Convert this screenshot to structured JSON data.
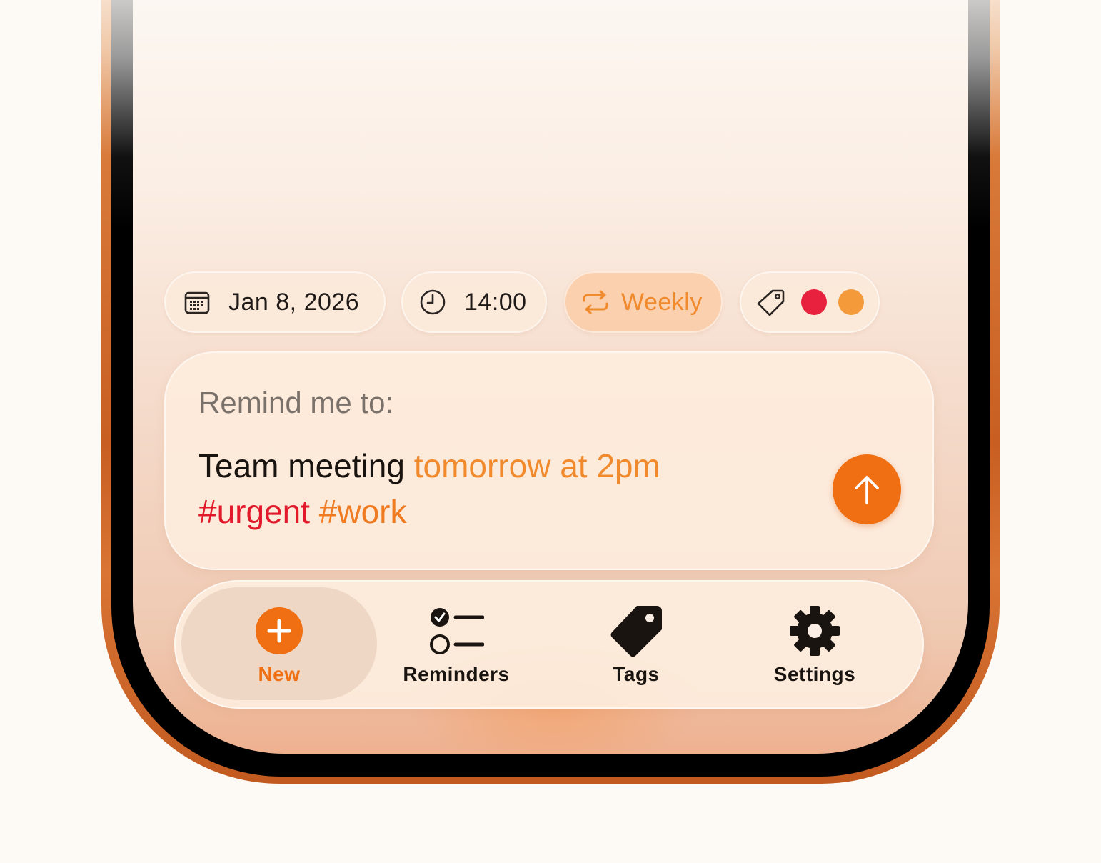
{
  "schedule": {
    "date": "Jan 8, 2026",
    "time": "14:00",
    "repeat": "Weekly",
    "tag_colors": [
      "#e8223e",
      "#f59a3a"
    ]
  },
  "composer": {
    "prompt": "Remind me to:",
    "text_plain": "Team meeting",
    "text_time": "tomorrow at 2pm",
    "tag_urgent": "#urgent",
    "tag_work": "#work"
  },
  "tabs": [
    {
      "label": "New",
      "icon": "plus-circle-icon",
      "active": true
    },
    {
      "label": "Reminders",
      "icon": "checklist-icon",
      "active": false
    },
    {
      "label": "Tags",
      "icon": "tag-icon",
      "active": false
    },
    {
      "label": "Settings",
      "icon": "gear-icon",
      "active": false
    }
  ],
  "colors": {
    "accent": "#f06f12",
    "time_highlight": "#f08a2c",
    "tag_red": "#e1192a",
    "tag_orange": "#f07a20",
    "frame": "#c85e22"
  }
}
